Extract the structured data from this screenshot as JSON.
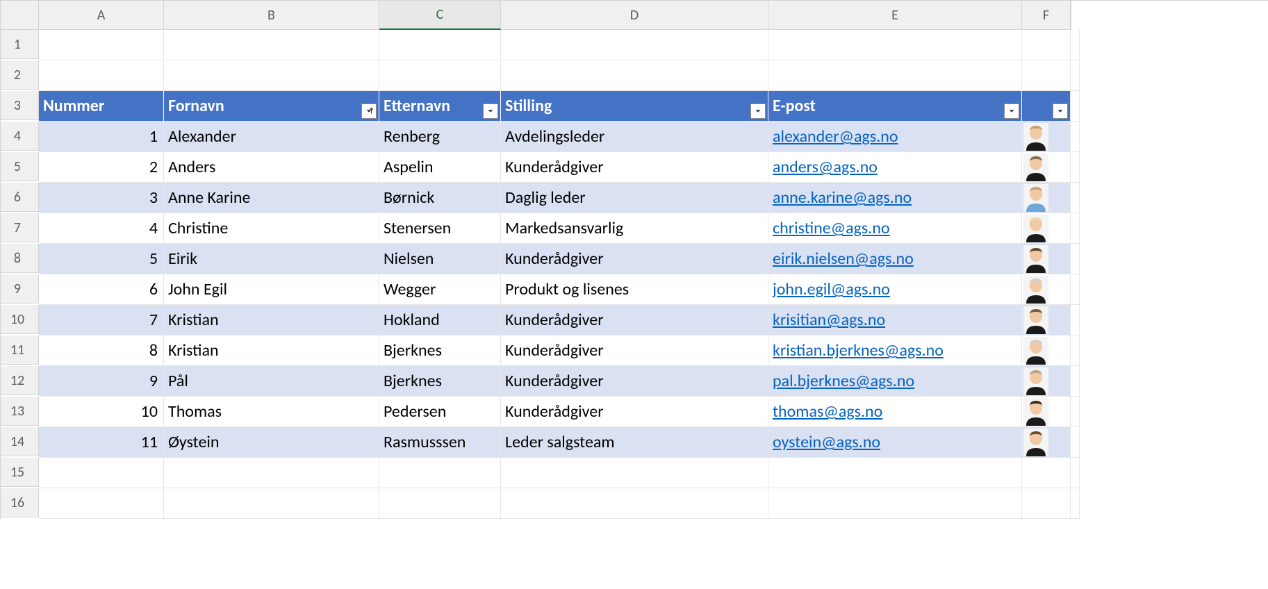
{
  "columns": [
    "A",
    "B",
    "C",
    "D",
    "E",
    "F"
  ],
  "rows": [
    "1",
    "2",
    "3",
    "4",
    "5",
    "6",
    "7",
    "8",
    "9",
    "10",
    "11",
    "12",
    "13",
    "14",
    "15",
    "16"
  ],
  "selected_column": "C",
  "table": {
    "headers": {
      "nummer": "Nummer",
      "fornavn": "Fornavn",
      "etternavn": "Etternavn",
      "stilling": "Stilling",
      "epost": "E-post",
      "bilde": ""
    },
    "rows": [
      {
        "n": "1",
        "f": "Alexander",
        "e": "Renberg",
        "s": "Avdelingsleder",
        "m": "alexander@ags.no",
        "shirt": "#1a1a1a",
        "hair": "#c8a070"
      },
      {
        "n": "2",
        "f": "Anders",
        "e": "Aspelin",
        "s": "Kunderådgiver",
        "m": "anders@ags.no",
        "shirt": "#1a1a1a",
        "hair": "#8b6b4a"
      },
      {
        "n": "3",
        "f": "Anne Karine",
        "e": "Børnick",
        "s": "Daglig leder",
        "m": "anne.karine@ags.no",
        "shirt": "#6ea8d8",
        "hair": "#bfa27a"
      },
      {
        "n": "4",
        "f": "Christine",
        "e": "Stenersen",
        "s": "Markedsansvarlig",
        "m": "christine@ags.no",
        "shirt": "#1a1a1a",
        "hair": "#e8d9a8"
      },
      {
        "n": "5",
        "f": "Eirik",
        "e": "Nielsen",
        "s": "Kunderådgiver",
        "m": "eirik.nielsen@ags.no",
        "shirt": "#1a1a1a",
        "hair": "#6b4a2a"
      },
      {
        "n": "6",
        "f": "John Egil",
        "e": "Wegger",
        "s": "Produkt og lisenes",
        "m": "john.egil@ags.no",
        "shirt": "#1a1a1a",
        "hair": "#d0d0d0"
      },
      {
        "n": "7",
        "f": "Kristian",
        "e": "Hokland",
        "s": "Kunderådgiver",
        "m": "krisitian@ags.no",
        "shirt": "#1a1a1a",
        "hair": "#7a5a3a"
      },
      {
        "n": "8",
        "f": "Kristian",
        "e": "Bjerknes",
        "s": "Kunderådgiver",
        "m": "kristian.bjerknes@ags.no",
        "shirt": "#1a1a1a",
        "hair": "#d0d0d0"
      },
      {
        "n": "9",
        "f": "Pål",
        "e": "Bjerknes",
        "s": "Kunderådgiver",
        "m": "pal.bjerknes@ags.no",
        "shirt": "#1a1a1a",
        "hair": "#c0a080"
      },
      {
        "n": "10",
        "f": "Thomas",
        "e": "Pedersen",
        "s": "Kunderådgiver",
        "m": "thomas@ags.no",
        "shirt": "#1a1a1a",
        "hair": "#3a2a1a"
      },
      {
        "n": "11",
        "f": "Øystein",
        "e": "Rasmusssen",
        "s": "Leder salgsteam",
        "m": "oystein@ags.no",
        "shirt": "#1a1a1a",
        "hair": "#6b4a2a"
      }
    ]
  }
}
